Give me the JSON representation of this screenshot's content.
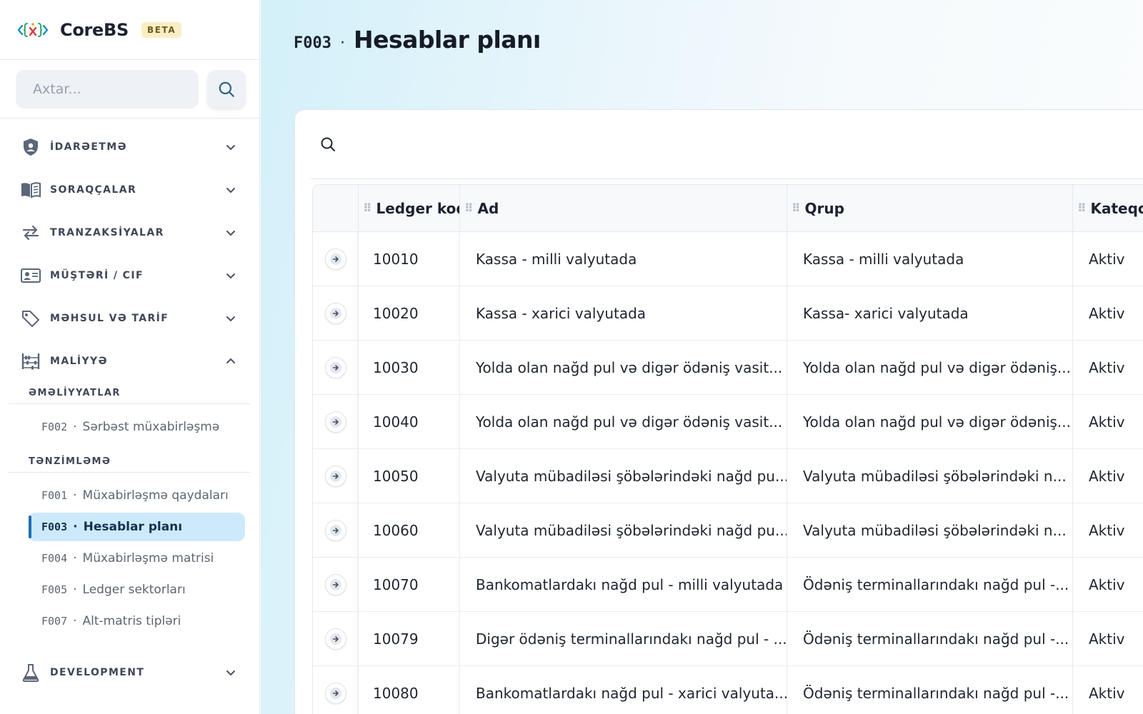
{
  "brand": {
    "name": "CoreBS",
    "badge": "BETA"
  },
  "sidebar": {
    "search_placeholder": "Axtar...",
    "groups": [
      {
        "label": "İDARƏETMƏ",
        "icon": "shield-user-icon"
      },
      {
        "label": "SORAQÇALAR",
        "icon": "book-icon"
      },
      {
        "label": "TRANZAKSİYALAR",
        "icon": "transfer-arrows-icon"
      },
      {
        "label": "MÜŞTƏRİ / CIF",
        "icon": "id-card-icon"
      },
      {
        "label": "MƏHSUL VƏ TARİF",
        "icon": "tag-icon"
      },
      {
        "label": "MALİYYƏ",
        "icon": "abacus-icon"
      },
      {
        "label": "DEVELOPMENT",
        "icon": "flask-icon"
      }
    ],
    "sections": {
      "operations": {
        "label": "ƏMƏLİYYATLAR",
        "items": [
          {
            "code": "F002",
            "label": "Sərbəst müxabirləşmə"
          }
        ]
      },
      "settings": {
        "label": "TƏNZİMLƏMƏ",
        "items": [
          {
            "code": "F001",
            "label": "Müxabirləşmə qaydaları"
          },
          {
            "code": "F003",
            "label": "Hesablar planı"
          },
          {
            "code": "F004",
            "label": "Müxabirləşmə matrisi"
          },
          {
            "code": "F005",
            "label": "Ledger sektorları"
          },
          {
            "code": "F007",
            "label": "Alt-matris tipləri"
          }
        ]
      }
    },
    "separator": "·",
    "active_item": "F003",
    "accent_color": "#1c6fb5",
    "active_bg": "#cdeafc"
  },
  "page": {
    "code": "F003",
    "separator": "·",
    "title": "Hesablar planı"
  },
  "table": {
    "columns": [
      "Ledger kodu",
      "Ad",
      "Qrup",
      "Kateqor"
    ],
    "rows": [
      [
        "10010",
        "Kassa - milli valyutada",
        "Kassa - milli valyutada",
        "Aktiv"
      ],
      [
        "10020",
        "Kassa - xarici valyutada",
        "Kassa- xarici valyutada",
        "Aktiv"
      ],
      [
        "10030",
        "Yolda olan nağd pul və digər ödəniş vasit...",
        "Yolda olan nağd pul və digər ödəniş...",
        "Aktiv"
      ],
      [
        "10040",
        "Yolda olan nağd pul və digər ödəniş vasit...",
        "Yolda olan nağd pul və digər ödəniş...",
        "Aktiv"
      ],
      [
        "10050",
        "Valyuta mübadiləsi şöbələrindəki nağd pu...",
        "Valyuta mübadiləsi şöbələrindəki n...",
        "Aktiv"
      ],
      [
        "10060",
        "Valyuta mübadiləsi şöbələrindəki nağd pu...",
        "Valyuta mübadiləsi şöbələrindəki n...",
        "Aktiv"
      ],
      [
        "10070",
        "Bankomatlardakı nağd pul - milli valyutada",
        "Ödəniş terminallarındakı nağd pul -...",
        "Aktiv"
      ],
      [
        "10079",
        "Digər ödəniş terminallarındakı nağd pul - ...",
        "Ödəniş terminallarındakı nağd pul -...",
        "Aktiv"
      ],
      [
        "10080",
        "Bankomatlardakı nağd pul - xarici valyuta...",
        "Ödəniş terminallarındakı nağd pul -...",
        "Aktiv"
      ]
    ]
  }
}
